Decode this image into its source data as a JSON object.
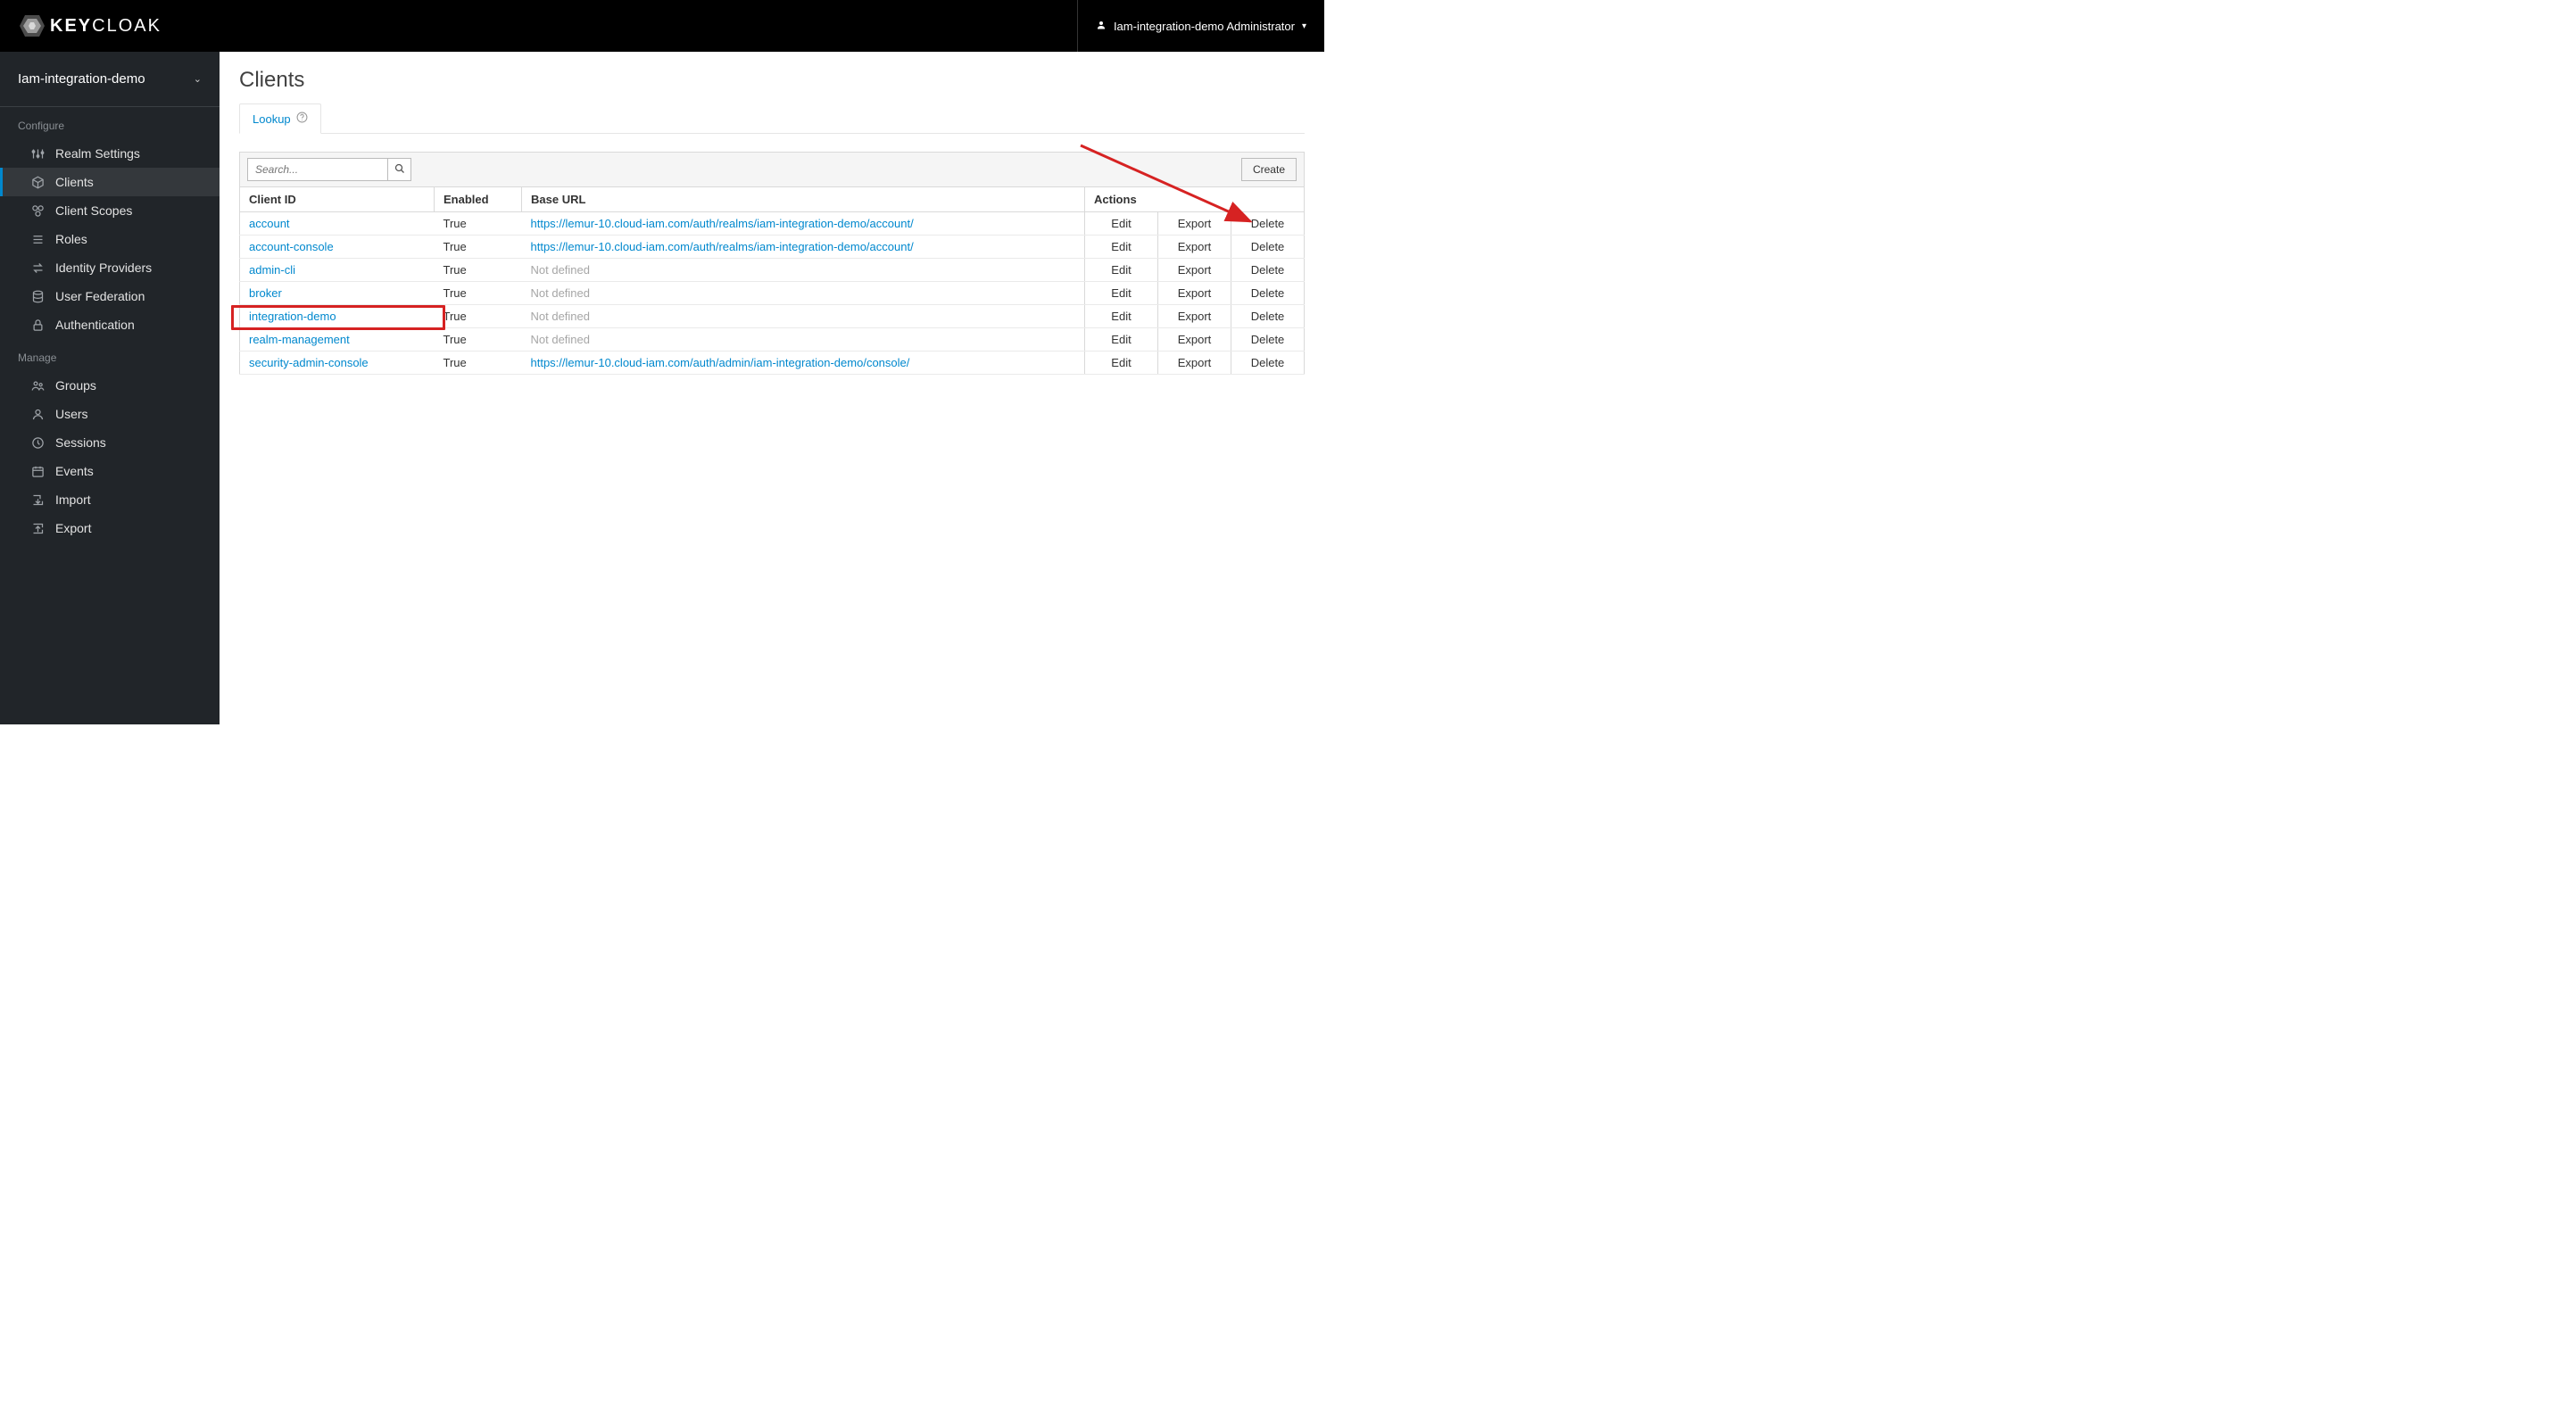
{
  "brand": {
    "name": "KEYCLOAK"
  },
  "user": {
    "display": "Iam-integration-demo Administrator"
  },
  "realm": {
    "name": "Iam-integration-demo"
  },
  "sidebar": {
    "configure_heading": "Configure",
    "manage_heading": "Manage",
    "configure": [
      {
        "label": "Realm Settings",
        "icon": "sliders"
      },
      {
        "label": "Clients",
        "icon": "cube",
        "active": true
      },
      {
        "label": "Client Scopes",
        "icon": "scopes"
      },
      {
        "label": "Roles",
        "icon": "list"
      },
      {
        "label": "Identity Providers",
        "icon": "swap"
      },
      {
        "label": "User Federation",
        "icon": "db"
      },
      {
        "label": "Authentication",
        "icon": "lock"
      }
    ],
    "manage": [
      {
        "label": "Groups",
        "icon": "groups"
      },
      {
        "label": "Users",
        "icon": "user"
      },
      {
        "label": "Sessions",
        "icon": "clock"
      },
      {
        "label": "Events",
        "icon": "calendar"
      },
      {
        "label": "Import",
        "icon": "import"
      },
      {
        "label": "Export",
        "icon": "export"
      }
    ]
  },
  "page": {
    "title": "Clients",
    "tab_label": "Lookup",
    "search_placeholder": "Search...",
    "create_label": "Create",
    "not_defined": "Not defined",
    "columns": {
      "client_id": "Client ID",
      "enabled": "Enabled",
      "base_url": "Base URL",
      "actions": "Actions"
    },
    "actions": {
      "edit": "Edit",
      "export": "Export",
      "delete": "Delete"
    },
    "rows": [
      {
        "client_id": "account",
        "enabled": "True",
        "base_url": "https://lemur-10.cloud-iam.com/auth/realms/iam-integration-demo/account/"
      },
      {
        "client_id": "account-console",
        "enabled": "True",
        "base_url": "https://lemur-10.cloud-iam.com/auth/realms/iam-integration-demo/account/"
      },
      {
        "client_id": "admin-cli",
        "enabled": "True",
        "base_url": null
      },
      {
        "client_id": "broker",
        "enabled": "True",
        "base_url": null
      },
      {
        "client_id": "integration-demo",
        "enabled": "True",
        "base_url": null,
        "highlight": true
      },
      {
        "client_id": "realm-management",
        "enabled": "True",
        "base_url": null
      },
      {
        "client_id": "security-admin-console",
        "enabled": "True",
        "base_url": "https://lemur-10.cloud-iam.com/auth/admin/iam-integration-demo/console/"
      }
    ]
  }
}
